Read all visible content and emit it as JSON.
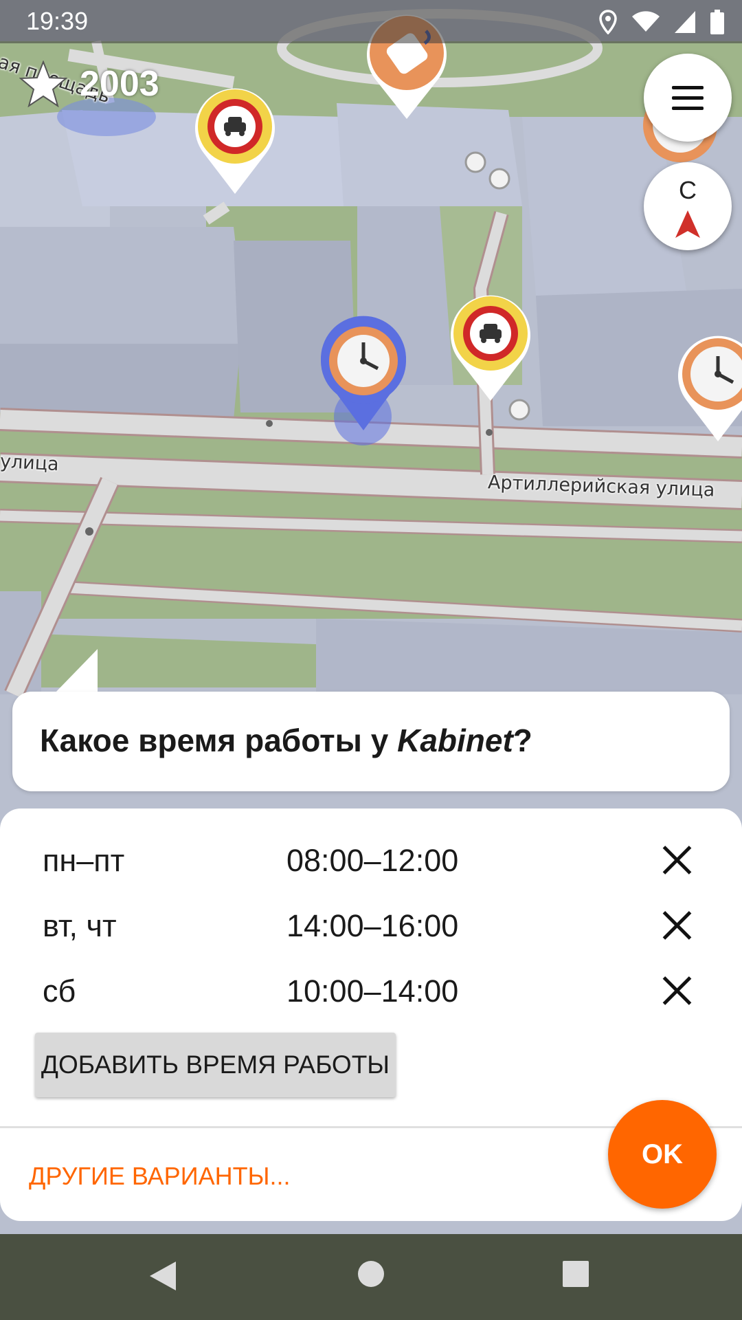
{
  "status_bar": {
    "time": "19:39",
    "icons": [
      "location-icon",
      "wifi-icon",
      "signal-icon",
      "battery-icon"
    ]
  },
  "map": {
    "points": "2003",
    "labels": {
      "square": "ая площадь",
      "street_left": "улица",
      "street_main": "Артиллерийская улица"
    },
    "compass_label": "С"
  },
  "question": {
    "prefix": "Какое время работы у ",
    "place": "Kabinet",
    "suffix": "?"
  },
  "opening_hours": [
    {
      "days": "пн–пт",
      "hours": "08:00–12:00"
    },
    {
      "days": "вт, чт",
      "hours": "14:00–16:00"
    },
    {
      "days": "сб",
      "hours": "10:00–14:00"
    }
  ],
  "actions": {
    "add_label": "ДОБАВИТЬ ВРЕМЯ РАБОТЫ",
    "other_label": "ДРУГИЕ ВАРИАНТЫ...",
    "ok_label": "OK"
  },
  "colors": {
    "accent": "#ff6600",
    "map_background": "#b9bfcf",
    "grass": "#9fb58a",
    "road": "#dcdcdc"
  }
}
